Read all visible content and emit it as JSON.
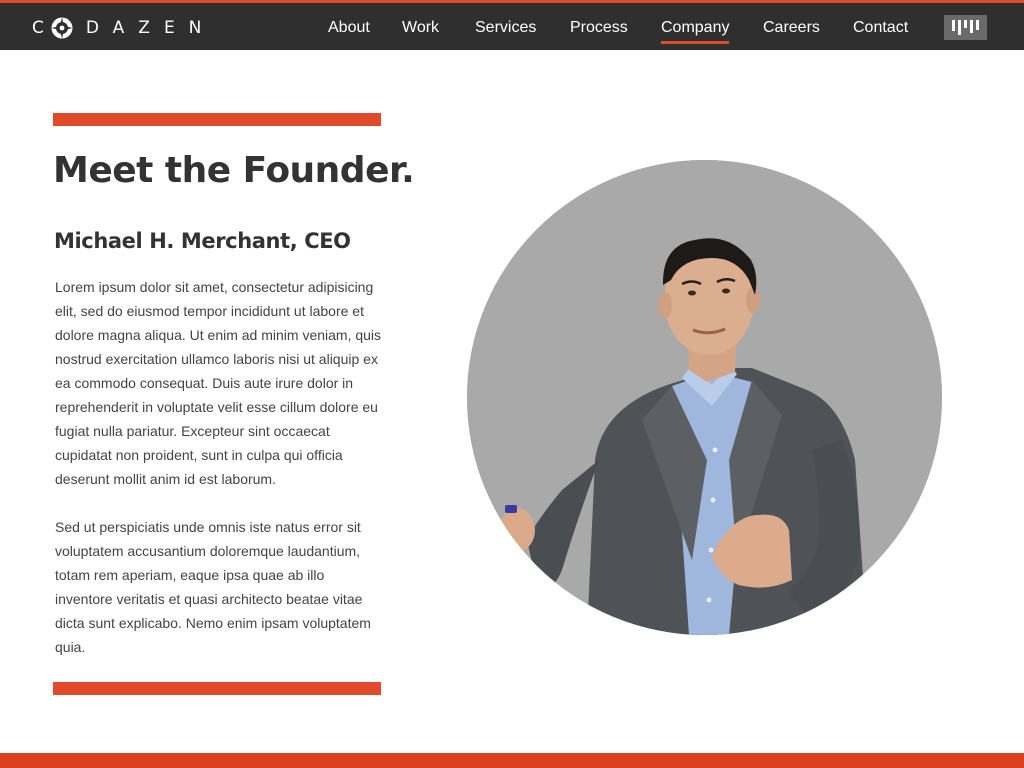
{
  "brand": {
    "name": "C DAZEN",
    "name_prefix": "C",
    "name_suffix": "DAZEN",
    "logo_icon": "compass-logo-icon",
    "accent_color": "#e04a2b"
  },
  "nav": {
    "items": [
      {
        "label": "About"
      },
      {
        "label": "Work"
      },
      {
        "label": "Services"
      },
      {
        "label": "Process"
      },
      {
        "label": "Company",
        "active": true
      },
      {
        "label": "Careers"
      },
      {
        "label": "Contact"
      }
    ],
    "menu_icon": "bars-menu-icon"
  },
  "main": {
    "title": "Meet the Founder.",
    "subtitle": "Michael H. Merchant, CEO",
    "paragraphs": [
      "Lorem ipsum dolor sit amet, consectetur adipisicing elit, sed do eiusmod tempor incididunt ut labore et dolore magna aliqua. Ut enim ad minim veniam, quis nostrud exercitation ullamco laboris nisi ut aliquip ex ea commodo consequat. Duis aute irure dolor in reprehenderit in voluptate velit esse cillum dolore eu fugiat nulla pariatur. Excepteur sint occaecat cupidatat non proident, sunt in culpa qui officia deserunt mollit anim id est laborum.",
      "Sed ut perspiciatis unde omnis iste natus error sit voluptatem accusantium doloremque laudantium, totam rem aperiam, eaque ipsa quae ab illo inventore veritatis et quasi architecto beatae vitae dicta sunt explicabo. Nemo enim ipsam voluptatem quia."
    ]
  },
  "portrait": {
    "subject": "founder-portrait-photo"
  }
}
